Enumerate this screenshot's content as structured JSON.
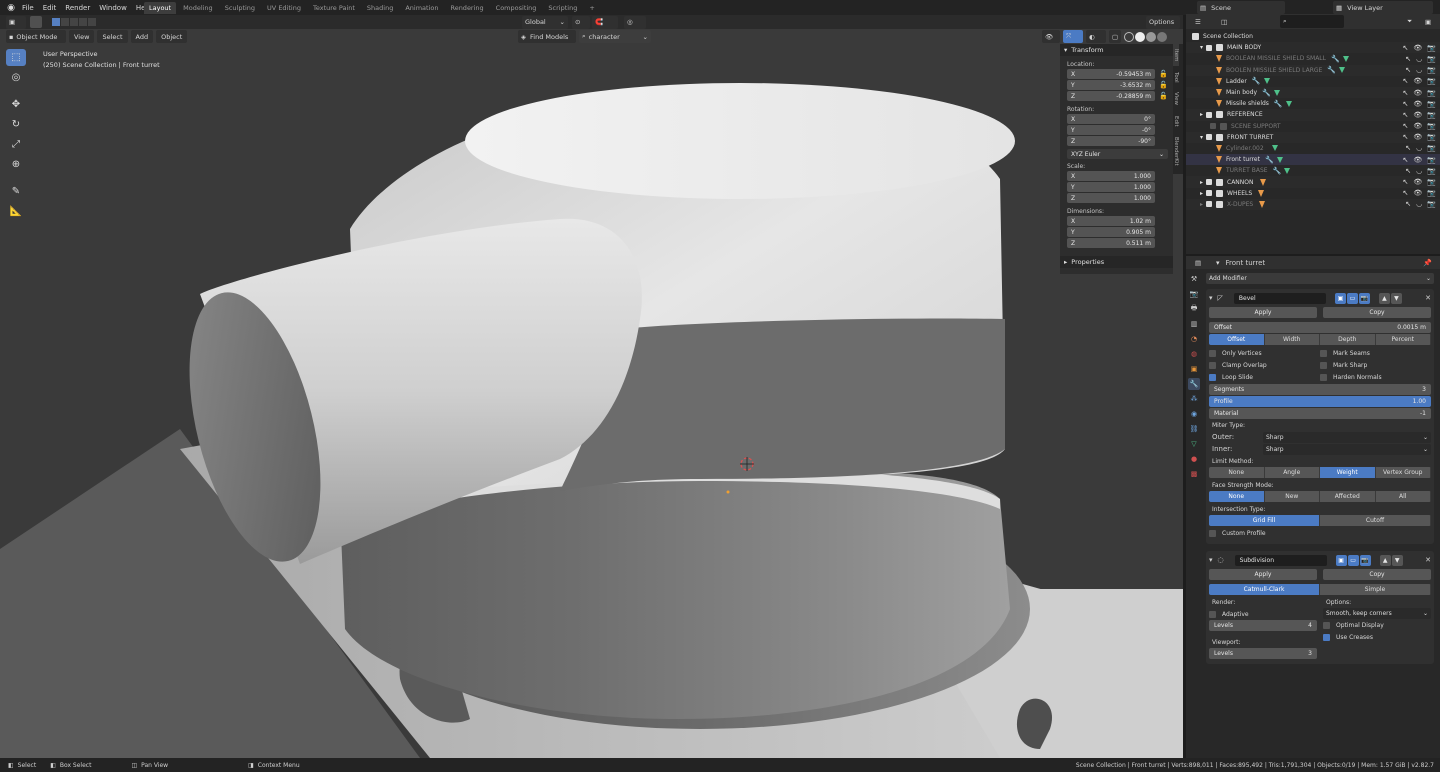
{
  "menu": [
    "File",
    "Edit",
    "Render",
    "Window",
    "Help"
  ],
  "workspaces": [
    "Layout",
    "Modeling",
    "Sculpting",
    "UV Editing",
    "Texture Paint",
    "Shading",
    "Animation",
    "Rendering",
    "Compositing",
    "Scripting"
  ],
  "active_workspace": "Layout",
  "header": {
    "orientation": "Global",
    "options": "Options",
    "scene": "Scene",
    "view_layer": "View Layer"
  },
  "viewport": {
    "mode": "Object Mode",
    "view": "View",
    "select": "Select",
    "add": "Add",
    "object": "Object",
    "find_models": "Find Models",
    "search_value": "character",
    "overlay_title": "User Perspective",
    "overlay_sub": "(250) Scene Collection | Front turret"
  },
  "npanel": {
    "transform": "Transform",
    "location": "Location:",
    "rotation": "Rotation:",
    "mode": "XYZ Euler",
    "scale": "Scale:",
    "dimensions": "Dimensions:",
    "properties": "Properties",
    "loc": [
      {
        "a": "X",
        "v": "-0.59453 m"
      },
      {
        "a": "Y",
        "v": "-3.6532 m"
      },
      {
        "a": "Z",
        "v": "-0.28859 m"
      }
    ],
    "rot": [
      {
        "a": "X",
        "v": "0°"
      },
      {
        "a": "Y",
        "v": "-0°"
      },
      {
        "a": "Z",
        "v": "-90°"
      }
    ],
    "scl": [
      {
        "a": "X",
        "v": "1.000"
      },
      {
        "a": "Y",
        "v": "1.000"
      },
      {
        "a": "Z",
        "v": "1.000"
      }
    ],
    "dim": [
      {
        "a": "X",
        "v": "1.02 m"
      },
      {
        "a": "Y",
        "v": "0.905 m"
      },
      {
        "a": "Z",
        "v": "0.511 m"
      }
    ],
    "tabs": [
      "Item",
      "Tool",
      "View",
      "Edit",
      "BlenderKit"
    ]
  },
  "outliner": {
    "root": "Scene Collection",
    "items": [
      {
        "name": "MAIN BODY"
      },
      {
        "name": "BOOLEAN MISSILE SHIELD SMALL"
      },
      {
        "name": "BOOLEN MISSILE SHIELD LARGE"
      },
      {
        "name": "Ladder"
      },
      {
        "name": "Main body"
      },
      {
        "name": "Missile shields"
      },
      {
        "name": "REFERENCE"
      },
      {
        "name": "SCENE SUPPORT"
      },
      {
        "name": "FRONT TURRET"
      },
      {
        "name": "Cylinder.002"
      },
      {
        "name": "Front turret"
      },
      {
        "name": "TURRET BASE"
      },
      {
        "name": "CANNON"
      },
      {
        "name": "WHEELS"
      },
      {
        "name": "X-DUPES"
      }
    ]
  },
  "properties": {
    "object": "Front turret",
    "add_modifier": "Add Modifier",
    "bevel": {
      "name": "Bevel",
      "apply": "Apply",
      "copy": "Copy",
      "offset_label": "Offset",
      "offset_value": "0.0015 m",
      "width_types": [
        "Offset",
        "Width",
        "Depth",
        "Percent"
      ],
      "only_vertices": "Only Vertices",
      "clamp_overlap": "Clamp Overlap",
      "loop_slide": "Loop Slide",
      "mark_seams": "Mark Seams",
      "mark_sharp": "Mark Sharp",
      "harden_normals": "Harden Normals",
      "segments_label": "Segments",
      "segments": "3",
      "profile_label": "Profile",
      "profile": "1.00",
      "material_label": "Material",
      "material": "-1",
      "miter": "Miter Type:",
      "outer_label": "Outer:",
      "outer": "Sharp",
      "inner_label": "Inner:",
      "inner": "Sharp",
      "limit": "Limit Method:",
      "limit_opts": [
        "None",
        "Angle",
        "Weight",
        "Vertex Group"
      ],
      "face": "Face Strength Mode:",
      "face_opts": [
        "None",
        "New",
        "Affected",
        "All"
      ],
      "intersection": "Intersection Type:",
      "inter_opts": [
        "Grid Fill",
        "Cutoff"
      ],
      "custom_profile": "Custom Profile"
    },
    "subdiv": {
      "name": "Subdivision",
      "apply": "Apply",
      "copy": "Copy",
      "types": [
        "Catmull-Clark",
        "Simple"
      ],
      "render": "Render:",
      "options": "Options:",
      "adaptive": "Adaptive",
      "levels_label": "Levels",
      "render_levels": "4",
      "viewport_levels": "3",
      "smooth": "Smooth, keep corners",
      "optimal": "Optimal Display",
      "creases": "Use Creases",
      "viewport": "Viewport:"
    }
  },
  "status": {
    "select": "Select",
    "box": "Box Select",
    "pan": "Pan View",
    "ctx": "Context Menu",
    "stats": "Scene Collection | Front turret | Verts:898,011 | Faces:895,492 | Tris:1,791,304 | Objects:0/19 | Mem: 1.57 GiB | v2.82.7"
  },
  "colors": {
    "accent": "#4b7bc4",
    "orange": "#e89a4a",
    "green": "#4fc18a"
  }
}
